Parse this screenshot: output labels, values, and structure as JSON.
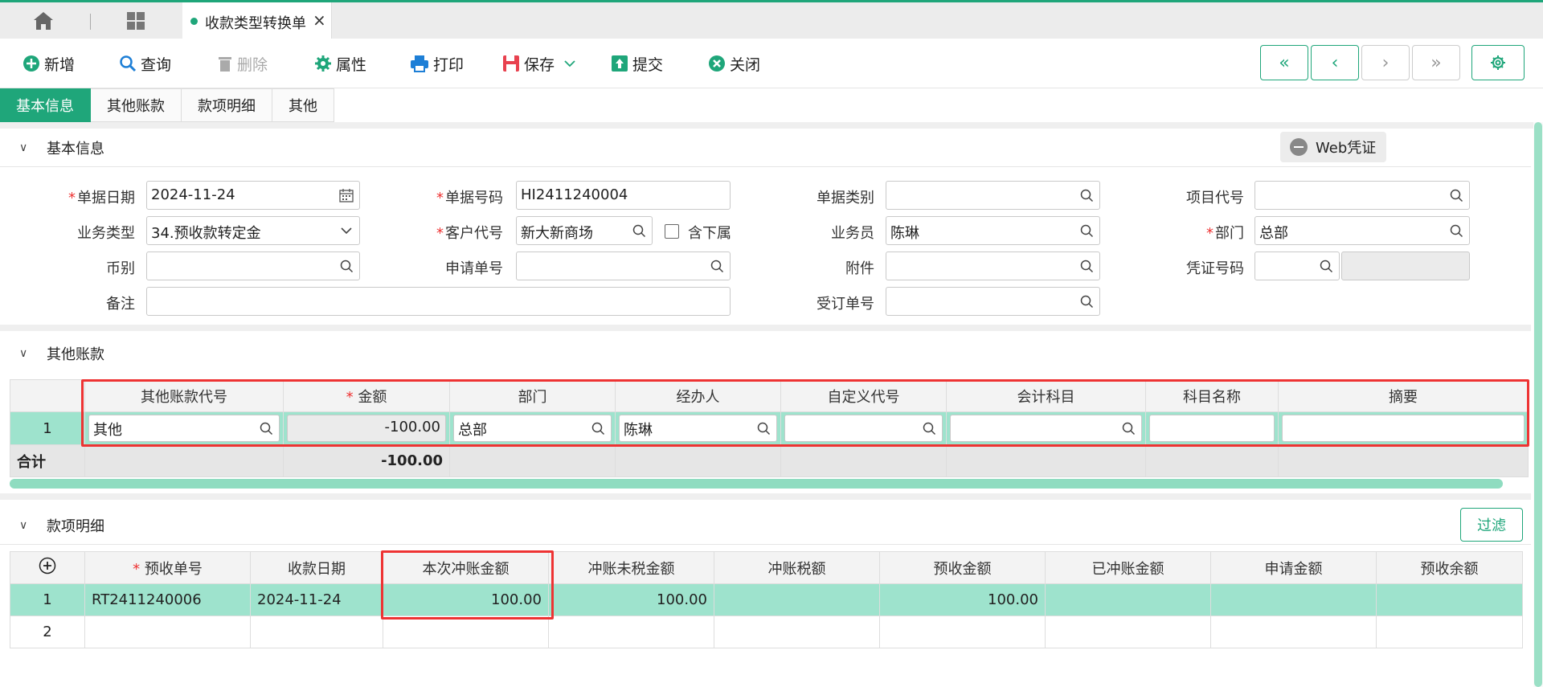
{
  "tabs": {
    "doc_title": "收款类型转换单"
  },
  "toolbar": {
    "new": "新增",
    "query": "查询",
    "delete": "删除",
    "props": "属性",
    "print": "打印",
    "save": "保存",
    "submit": "提交",
    "close": "关闭"
  },
  "section_tabs": [
    "基本信息",
    "其他账款",
    "款项明细",
    "其他"
  ],
  "basic": {
    "title": "基本信息",
    "web_voucher": "Web凭证",
    "labels": {
      "date": "单据日期",
      "docno": "单据号码",
      "doctype": "单据类别",
      "projcode": "项目代号",
      "biztype": "业务类型",
      "custcode": "客户代号",
      "include_sub": "含下属",
      "salesman": "业务员",
      "dept": "部门",
      "currency": "币别",
      "applyno": "申请单号",
      "attach": "附件",
      "voucherno": "凭证号码",
      "remark": "备注",
      "orderno": "受订单号"
    },
    "values": {
      "date": "2024-11-24",
      "docno": "HI2411240004",
      "doctype": "",
      "projcode": "",
      "biztype": "34.预收款转定金",
      "custcode": "新大新商场",
      "salesman": "陈琳",
      "dept": "总部",
      "currency": "",
      "applyno": "",
      "attach": "",
      "voucherno": "",
      "remark": "",
      "orderno": ""
    }
  },
  "other": {
    "title": "其他账款",
    "columns": [
      "其他账款代号",
      "金额",
      "部门",
      "经办人",
      "自定义代号",
      "会计科目",
      "科目名称",
      "摘要"
    ],
    "rows": [
      {
        "no": "1",
        "code": "其他",
        "amount": "-100.00",
        "dept": "总部",
        "handler": "陈琳",
        "custom": "",
        "account": "",
        "accname": "",
        "summary": ""
      }
    ],
    "total_label": "合计",
    "total_amount": "-100.00"
  },
  "detail": {
    "title": "款项明细",
    "filter": "过滤",
    "columns": [
      "预收单号",
      "收款日期",
      "本次冲账金额",
      "冲账未税金额",
      "冲账税额",
      "预收金额",
      "已冲账金额",
      "申请金额",
      "预收余额"
    ],
    "rows": [
      {
        "no": "1",
        "prepayno": "RT2411240006",
        "date": "2024-11-24",
        "offset": "100.00",
        "untaxed": "100.00",
        "tax": "",
        "prepay": "100.00",
        "offset_done": "",
        "apply": "",
        "balance": ""
      },
      {
        "no": "2",
        "prepayno": "",
        "date": "",
        "offset": "",
        "untaxed": "",
        "tax": "",
        "prepay": "",
        "offset_done": "",
        "apply": "",
        "balance": ""
      }
    ]
  },
  "colors": {
    "accent": "#1fa67a",
    "row_selected": "#9ee3cd",
    "highlight_box": "#e33333"
  }
}
